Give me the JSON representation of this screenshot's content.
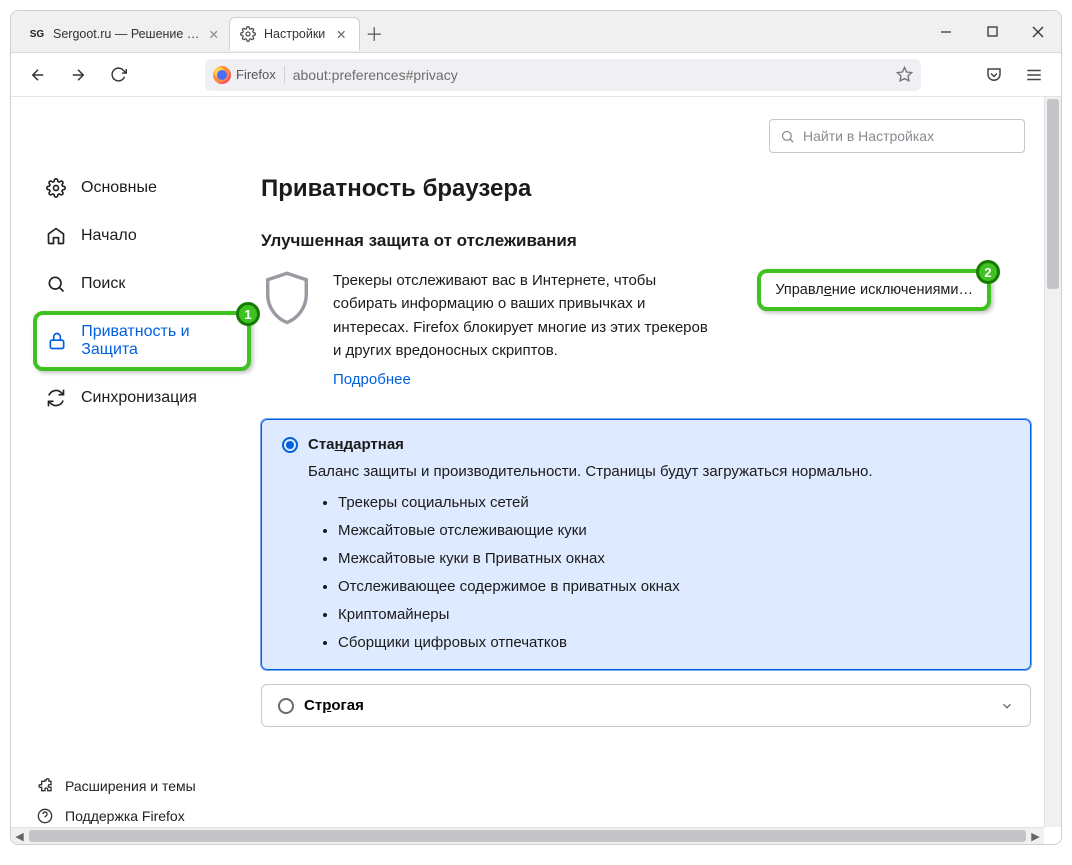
{
  "window": {
    "tabs": [
      {
        "label": "Sergoot.ru — Решение ваших",
        "active": false
      },
      {
        "label": "Настройки",
        "active": true
      }
    ]
  },
  "urlbar": {
    "product": "Firefox",
    "address": "about:preferences#privacy"
  },
  "toolbar_icons": {
    "pocket": "pocket-icon",
    "menu": "menu-icon",
    "star": "star-icon"
  },
  "search": {
    "placeholder": "Найти в Настройках"
  },
  "sidebar": {
    "items": [
      {
        "icon": "gear-icon",
        "label": "Основные"
      },
      {
        "icon": "home-icon",
        "label": "Начало"
      },
      {
        "icon": "search-icon",
        "label": "Поиск"
      },
      {
        "icon": "lock-icon",
        "label": "Приватность и Защита",
        "selected": true,
        "callout": "1"
      },
      {
        "icon": "sync-icon",
        "label": "Синхронизация"
      }
    ],
    "bottom": [
      {
        "icon": "puzzle-icon",
        "label": "Расширения и темы"
      },
      {
        "icon": "help-icon",
        "label": "Поддержка Firefox"
      }
    ]
  },
  "page": {
    "title": "Приватность браузера",
    "tracking": {
      "heading": "Улучшенная защита от отслеживания",
      "body": "Трекеры отслеживают вас в Интернете, чтобы собирать информацию о ваших привычках и интересах. Firefox блокирует многие из этих трекеров и других вредоносных скриптов.",
      "learn_more": "Подробнее",
      "exceptions_button_pre": "Управл",
      "exceptions_button_ul": "е",
      "exceptions_button_post": "ние исключениями…",
      "exceptions_callout": "2"
    },
    "options": {
      "standard": {
        "label_pre": "Ста",
        "label_ul": "н",
        "label_post": "дартная",
        "subtitle": "Баланс защиты и производительности. Страницы будут загружаться нормально.",
        "items": [
          "Трекеры социальных сетей",
          "Межсайтовые отслеживающие куки",
          "Межсайтовые куки в Приватных окнах",
          "Отслеживающее содержимое в приватных окнах",
          "Криптомайнеры",
          "Сборщики цифровых отпечатков"
        ]
      },
      "strict": {
        "label_pre": "Ст",
        "label_ul": "р",
        "label_post": "огая"
      }
    }
  }
}
